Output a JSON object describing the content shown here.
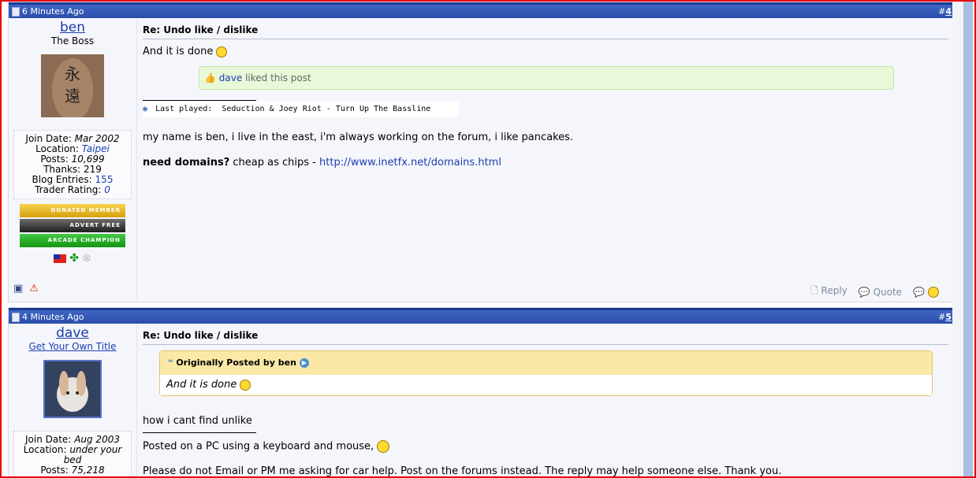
{
  "posts": [
    {
      "time": "6 Minutes Ago",
      "number": "#4",
      "number_hash": "#",
      "number_value": "4",
      "user": {
        "name": "ben",
        "title": "The Boss",
        "avatar_text_1": "永",
        "avatar_text_2": "遠",
        "join_date_label": "Join Date:",
        "join_date": "Mar 2002",
        "location_label": "Location:",
        "location": "Taipei",
        "posts_label": "Posts:",
        "posts": "10,699",
        "thanks_label": "Thanks:",
        "thanks": "219",
        "blog_label": "Blog Entries:",
        "blog": "155",
        "trader_label": "Trader Rating:",
        "trader": "0",
        "badges": [
          "DONATED MEMBER",
          "ADVERT FREE",
          "ARCADE CHAMPION"
        ]
      },
      "title": "Re: Undo like / dislike",
      "body": "And it is done",
      "liked_user": "dave",
      "liked_text": "liked this post",
      "last_played_label": "Last played:",
      "last_played": "Seduction & Joey Riot - Turn Up The Bassline",
      "signature": "my name is ben, i live in the east, i'm always working on the forum, i like pancakes.",
      "domains_bold": "need domains?",
      "domains_text": "cheap as chips -",
      "domains_link": "http://www.inetfx.net/domains.html",
      "reply_label": "Reply",
      "quote_label": "Quote"
    },
    {
      "time": "4 Minutes Ago",
      "number_hash": "#",
      "number_value": "5",
      "user": {
        "name": "dave",
        "title": "Get Your Own Title",
        "join_date_label": "Join Date:",
        "join_date": "Aug 2003",
        "location_label": "Location:",
        "location": "under your bed",
        "posts_label": "Posts:",
        "posts": "75,218"
      },
      "title": "Re: Undo like / dislike",
      "quote_author_label": "Originally Posted by",
      "quote_author": "ben",
      "quote_text": "And it is done",
      "body": "how i cant find unlike",
      "sig_line1": "Posted on a PC using a keyboard and mouse,",
      "sig_line2": "Please do not Email or PM me asking for car help. Post on the forums instead. The reply may help someone else. Thank you."
    }
  ]
}
